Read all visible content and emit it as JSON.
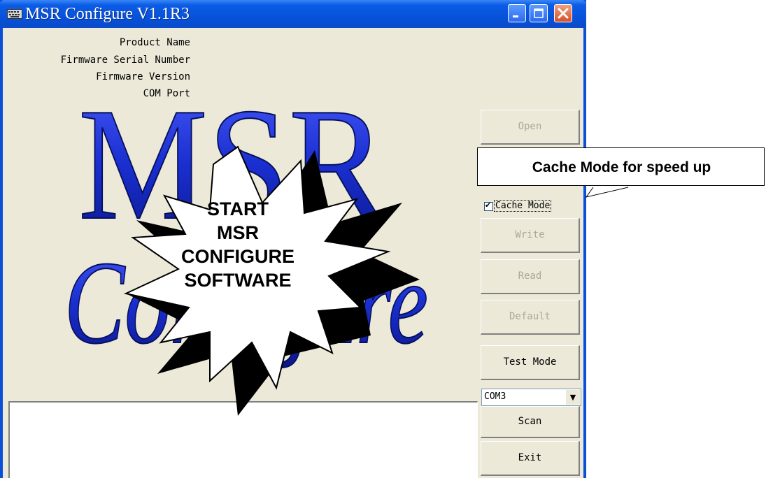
{
  "window": {
    "title": "MSR Configure V1.1R3",
    "icon": "keyboard-icon",
    "controls": {
      "minimize": "minimize-icon",
      "maximize": "maximize-icon",
      "close": "close-icon"
    }
  },
  "info": {
    "product_name": "Product Name",
    "firmware_serial": "Firmware Serial Number",
    "firmware_version": "Firmware Version",
    "com_port": "COM Port"
  },
  "logo": {
    "line1": "MSR",
    "line2": "Configure",
    "color": "#1a2fd0"
  },
  "buttons": {
    "open": "Open",
    "write": "Write",
    "read": "Read",
    "default": "Default",
    "test_mode": "Test Mode",
    "scan": "Scan",
    "exit": "Exit"
  },
  "cache_mode": {
    "label": "Cache Mode",
    "checked": true,
    "mark": "✔"
  },
  "port_select": {
    "value": "COM3",
    "arrow": "▼"
  },
  "callout": {
    "text": "Cache Mode for speed up"
  },
  "burst": {
    "lines": [
      "START",
      "MSR",
      "CONFIGURE",
      "SOFTWARE"
    ]
  },
  "colors": {
    "titlebar": "#0750d8",
    "dialog": "#ece9d8",
    "disabled_text": "#aca899"
  }
}
